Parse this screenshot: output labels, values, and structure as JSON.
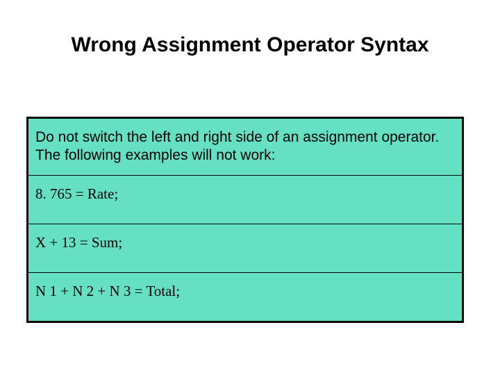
{
  "title": "Wrong Assignment Operator Syntax",
  "intro": "Do not switch the left and right side of an assignment operator. The following examples will not work:",
  "examples": [
    "8. 765 = Rate;",
    "X + 13 = Sum;",
    "N 1 + N 2 + N 3 = Total;"
  ]
}
